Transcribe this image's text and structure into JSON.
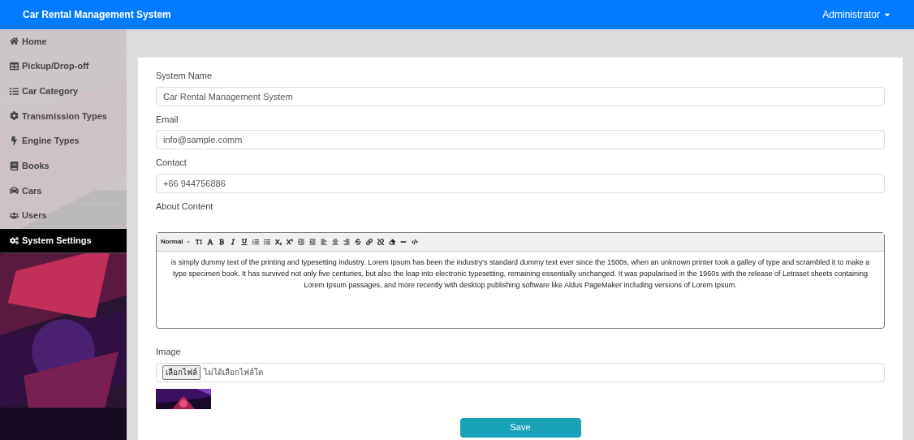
{
  "header": {
    "title": "Car Rental Management System",
    "user_menu": "Administrator"
  },
  "sidebar": {
    "items": [
      {
        "label": "Home",
        "kind": "home",
        "selected": false
      },
      {
        "label": "Pickup/Drop-off",
        "kind": "table",
        "selected": false
      },
      {
        "label": "Car Category",
        "kind": "list",
        "selected": false
      },
      {
        "label": "Transmission Types",
        "kind": "gear",
        "selected": false
      },
      {
        "label": "Engine Types",
        "kind": "bolt",
        "selected": false
      },
      {
        "label": "Books",
        "kind": "book",
        "selected": false
      },
      {
        "label": "Cars",
        "kind": "car",
        "selected": false
      },
      {
        "label": "Users",
        "kind": "users",
        "selected": false
      },
      {
        "label": "System Settings",
        "kind": "gears",
        "selected": true
      }
    ]
  },
  "form": {
    "fields": [
      {
        "label": "System Name",
        "value": "Car Rental Management System"
      },
      {
        "label": "Email",
        "value": "info@sample.comm"
      },
      {
        "label": "Contact",
        "value": "+66 944756886"
      }
    ],
    "about": {
      "label": "About Content",
      "style_select": "Normal",
      "content": "is simply dummy text of the printing and typesetting industry. Lorem Ipsum has been the industry's standard dummy text ever since the 1500s, when an unknown printer took a galley of type and scrambled it to make a type specimen book. It has survived not only five centuries, but also the leap into electronic typesetting, remaining essentially unchanged. It was popularised in the 1960s with the release of Letraset sheets containing Lorem Ipsum passages, and more recently with desktop publishing software like Aldus PageMaker including versions of Lorem Ipsum."
    },
    "image": {
      "label": "Image",
      "choose_button": "เลือกไฟล์",
      "file_status": "ไม่ได้เลือกไฟล์ใด"
    },
    "save_button": "Save"
  }
}
